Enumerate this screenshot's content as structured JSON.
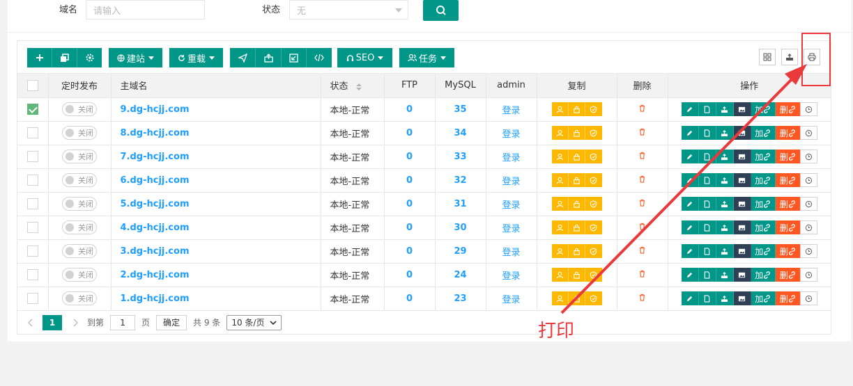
{
  "filter": {
    "domain_label": "域名",
    "domain_placeholder": "请输入",
    "status_label": "状态",
    "status_value": "无"
  },
  "toolbar": {
    "site_label": "建站",
    "reload_label": "重载",
    "seo_label": "SEO",
    "task_label": "任务"
  },
  "table": {
    "headers": {
      "schedule": "定时发布",
      "domain": "主域名",
      "status": "状态",
      "ftp": "FTP",
      "mysql": "MySQL",
      "admin": "admin",
      "copy": "复制",
      "delete": "删除",
      "ops": "操作"
    },
    "switch_label": "关闭",
    "login_label": "登录",
    "add_label": "加",
    "del_label": "删",
    "rows": [
      {
        "checked": true,
        "domain": "9.dg-hcjj.com",
        "status": "本地-正常",
        "ftp": "0",
        "mysql": "35"
      },
      {
        "checked": false,
        "domain": "8.dg-hcjj.com",
        "status": "本地-正常",
        "ftp": "0",
        "mysql": "34"
      },
      {
        "checked": false,
        "domain": "7.dg-hcjj.com",
        "status": "本地-正常",
        "ftp": "0",
        "mysql": "33"
      },
      {
        "checked": false,
        "domain": "6.dg-hcjj.com",
        "status": "本地-正常",
        "ftp": "0",
        "mysql": "32"
      },
      {
        "checked": false,
        "domain": "5.dg-hcjj.com",
        "status": "本地-正常",
        "ftp": "0",
        "mysql": "31"
      },
      {
        "checked": false,
        "domain": "4.dg-hcjj.com",
        "status": "本地-正常",
        "ftp": "0",
        "mysql": "30"
      },
      {
        "checked": false,
        "domain": "3.dg-hcjj.com",
        "status": "本地-正常",
        "ftp": "0",
        "mysql": "29"
      },
      {
        "checked": false,
        "domain": "2.dg-hcjj.com",
        "status": "本地-正常",
        "ftp": "0",
        "mysql": "24"
      },
      {
        "checked": false,
        "domain": "1.dg-hcjj.com",
        "status": "本地-正常",
        "ftp": "0",
        "mysql": "23"
      }
    ]
  },
  "pager": {
    "current": "1",
    "goto_label": "到第",
    "goto_value": "1",
    "page_unit": "页",
    "confirm_label": "确定",
    "total_label": "共 9 条",
    "page_size": "10 条/页"
  },
  "annotation": {
    "text": "打印",
    "color": "#e9393a"
  },
  "colors": {
    "primary": "#009688",
    "link": "#1e9fff",
    "warn": "#ffb800",
    "danger": "#ff5722",
    "dark": "#2f4056"
  }
}
